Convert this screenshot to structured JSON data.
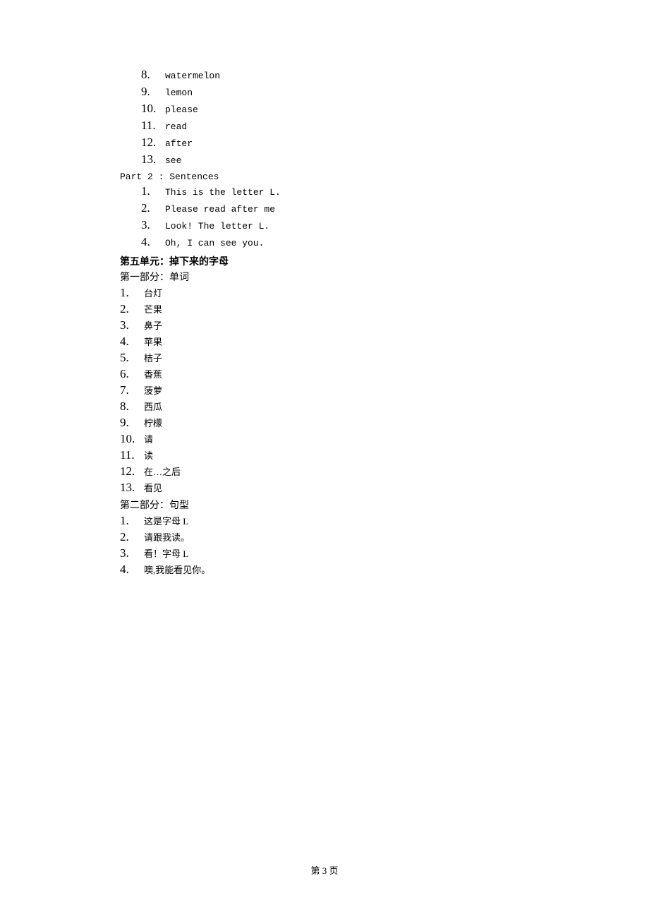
{
  "top_words": [
    "watermelon",
    "lemon",
    "please",
    "read",
    "after",
    "see"
  ],
  "part2_header": "Part 2 : Sentences",
  "sentences_en": [
    "This is the letter L.",
    "Please read after me",
    "Look! The letter L.",
    "Oh, I can see you."
  ],
  "unit_title": "第五单元：掉下来的字母",
  "part1_header_cn": "第一部分：单词",
  "words_cn": [
    "台灯",
    "芒果",
    "鼻子",
    "苹果",
    "桔子",
    "香蕉",
    "菠萝",
    "西瓜",
    "柠檬",
    "请",
    "读",
    "在…之后",
    "看见"
  ],
  "part2_header_cn": "第二部分：句型",
  "sentences_cn": [
    "这是字母 L",
    "请跟我读。",
    "看！字母 L",
    "噢,我能看见你。"
  ],
  "footer": "第 3 页"
}
